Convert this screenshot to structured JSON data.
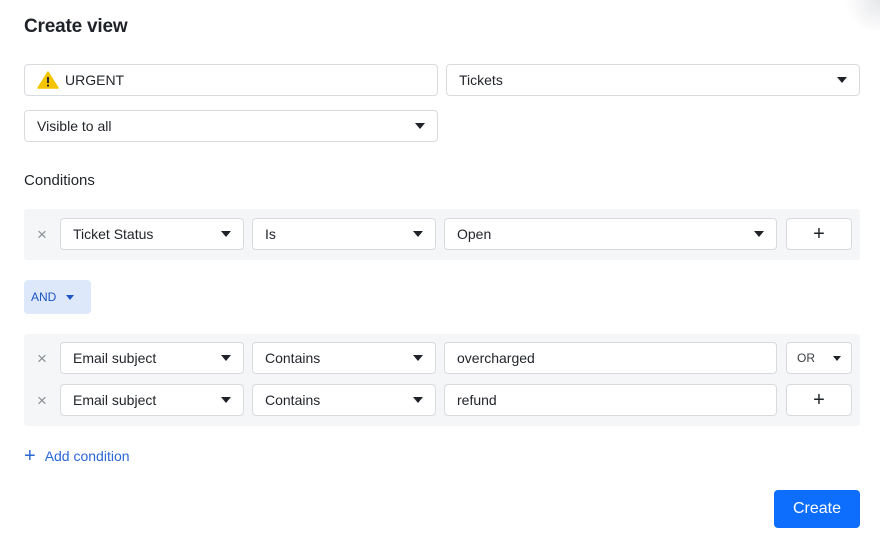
{
  "dialog": {
    "title": "Create view"
  },
  "view_name": {
    "icon": "warning-icon",
    "value": "URGENT"
  },
  "object_type": {
    "selected": "Tickets"
  },
  "visibility": {
    "selected": "Visible to all"
  },
  "conditions": {
    "label": "Conditions",
    "group1": [
      {
        "field": "Ticket Status",
        "operator": "Is",
        "value": "Open",
        "value_type": "select",
        "action": "+"
      }
    ],
    "group_connector": "AND",
    "group2": [
      {
        "field": "Email subject",
        "operator": "Contains",
        "value": "overcharged",
        "value_type": "text",
        "action": "OR"
      },
      {
        "field": "Email subject",
        "operator": "Contains",
        "value": "refund",
        "value_type": "text",
        "action": "+"
      }
    ],
    "remove_glyph": "×",
    "add_condition": {
      "icon": "+",
      "label": "Add condition"
    }
  },
  "footer": {
    "create_label": "Create"
  },
  "colors": {
    "primary": "#0d6efd",
    "link": "#2a67d6",
    "and_bg": "#dde8fb",
    "group_bg": "#f5f6f8"
  }
}
